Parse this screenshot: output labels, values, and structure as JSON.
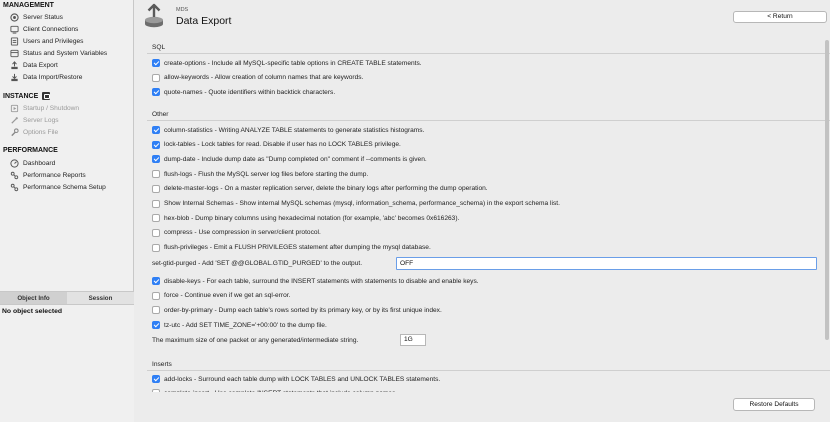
{
  "sidebar": {
    "management": {
      "title": "MANAGEMENT",
      "items": [
        {
          "label": "Server Status",
          "icon": "server-status-icon"
        },
        {
          "label": "Client Connections",
          "icon": "client-connections-icon"
        },
        {
          "label": "Users and Privileges",
          "icon": "users-icon"
        },
        {
          "label": "Status and System Variables",
          "icon": "variables-icon"
        },
        {
          "label": "Data Export",
          "icon": "data-export-icon"
        },
        {
          "label": "Data Import/Restore",
          "icon": "data-import-icon"
        }
      ]
    },
    "instance": {
      "title": "INSTANCE",
      "items": [
        {
          "label": "Startup / Shutdown",
          "icon": "startup-icon"
        },
        {
          "label": "Server Logs",
          "icon": "server-logs-icon"
        },
        {
          "label": "Options File",
          "icon": "options-file-icon"
        }
      ]
    },
    "performance": {
      "title": "PERFORMANCE",
      "items": [
        {
          "label": "Dashboard",
          "icon": "dashboard-icon"
        },
        {
          "label": "Performance Reports",
          "icon": "performance-reports-icon"
        },
        {
          "label": "Performance Schema Setup",
          "icon": "performance-schema-icon"
        }
      ]
    }
  },
  "object_panel": {
    "tabs": [
      "Object Info",
      "Session"
    ],
    "empty_text": "No object selected"
  },
  "header": {
    "db_label": "MDS",
    "title": "Data Export",
    "return_label": "< Return"
  },
  "sql_section": {
    "title": "SQL",
    "options": [
      {
        "checked": true,
        "label": "create-options - Include all MySQL-specific table options in CREATE TABLE statements."
      },
      {
        "checked": false,
        "label": "allow-keywords - Allow creation of column names that are keywords."
      },
      {
        "checked": true,
        "label": "quote-names - Quote identifiers within backtick characters."
      }
    ]
  },
  "other_section": {
    "title": "Other",
    "options": [
      {
        "checked": true,
        "label": "column-statistics - Writing ANALYZE TABLE statements to generate statistics histograms."
      },
      {
        "checked": true,
        "label": "lock-tables - Lock tables for read. Disable if user has no LOCK TABLES privilege."
      },
      {
        "checked": true,
        "label": "dump-date - Include dump date as \"Dump completed on\" comment if --comments is given."
      },
      {
        "checked": false,
        "label": "flush-logs - Flush the MySQL server log files before starting the dump."
      },
      {
        "checked": false,
        "label": "delete-master-logs - On a master replication server, delete the binary logs after performing the dump operation."
      },
      {
        "checked": false,
        "label": "Show Internal Schemas - Show internal MySQL schemas (mysql, information_schema, performance_schema) in the export schema list."
      },
      {
        "checked": false,
        "label": "hex-blob - Dump binary columns using hexadecimal notation (for example, 'abc' becomes 0x616263)."
      },
      {
        "checked": false,
        "label": "compress - Use compression in server/client protocol."
      },
      {
        "checked": false,
        "label": "flush-privileges - Emit a FLUSH PRIVILEGES statement after dumping the mysql database."
      }
    ],
    "gtid_label": "set-gtid-purged - Add 'SET @@GLOBAL.GTID_PURGED' to the output.",
    "gtid_value": "OFF",
    "options2": [
      {
        "checked": true,
        "label": "disable-keys - For each table, surround the INSERT statements with statements to disable and enable keys."
      },
      {
        "checked": false,
        "label": "force - Continue even if we get an sql-error."
      },
      {
        "checked": false,
        "label": "order-by-primary - Dump each table's rows sorted by its primary key, or by its first unique index."
      },
      {
        "checked": true,
        "label": "tz-utc - Add SET TIME_ZONE='+00:00' to the dump file."
      }
    ],
    "packet_label": "The maximum size of one packet or any generated/intermediate string.",
    "packet_value": "1G"
  },
  "inserts_section": {
    "title": "Inserts",
    "options": [
      {
        "checked": true,
        "label": "add-locks - Surround each table dump with LOCK TABLES and UNLOCK TABLES statements."
      },
      {
        "checked": false,
        "label": "complete-insert - Use complete INSERT statements that include column names."
      }
    ]
  },
  "footer": {
    "restore_label": "Restore Defaults"
  },
  "colors": {
    "accent": "#2f7ff5",
    "sidebar_bg": "#f0f0f0",
    "main_bg": "#ececec"
  }
}
